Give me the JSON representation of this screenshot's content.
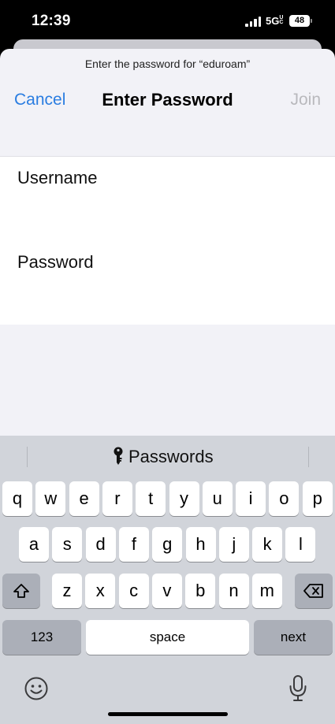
{
  "status_bar": {
    "time": "12:39",
    "network": "5G",
    "network_suffix": "UC",
    "battery": "48"
  },
  "sheet": {
    "prompt": "Enter the password for “eduroam”",
    "cancel_label": "Cancel",
    "title": "Enter Password",
    "join_label": "Join",
    "fields": {
      "username_label": "Username",
      "password_label": "Password"
    }
  },
  "keyboard": {
    "suggestion": "Passwords",
    "row1": [
      "q",
      "w",
      "e",
      "r",
      "t",
      "y",
      "u",
      "i",
      "o",
      "p"
    ],
    "row2": [
      "a",
      "s",
      "d",
      "f",
      "g",
      "h",
      "j",
      "k",
      "l"
    ],
    "row3": [
      "z",
      "x",
      "c",
      "v",
      "b",
      "n",
      "m"
    ],
    "numbers_label": "123",
    "space_label": "space",
    "next_label": "next",
    "icons": {
      "shift": "shift-icon",
      "delete": "backspace-icon",
      "emoji": "emoji-icon",
      "dictation": "microphone-icon",
      "key": "key-icon"
    }
  },
  "colors": {
    "accent": "#2a7de1",
    "disabled": "#b9b9bd",
    "keyboard_bg": "#d1d4da",
    "key_dark": "#abafb8"
  }
}
